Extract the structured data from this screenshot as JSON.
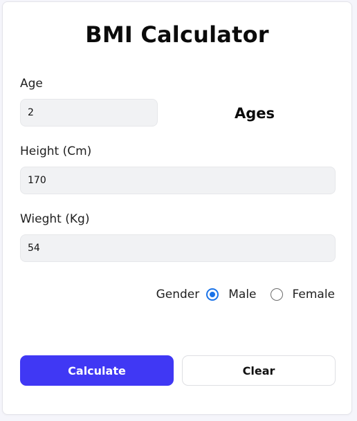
{
  "title": "BMI Calculator",
  "age": {
    "label": "Age",
    "value": "2",
    "side_label": "Ages"
  },
  "height": {
    "label": "Height (Cm)",
    "value": "170"
  },
  "weight": {
    "label": "Wieght (Kg)",
    "value": "54"
  },
  "gender": {
    "label": "Gender",
    "options": [
      {
        "label": "Male",
        "checked": true
      },
      {
        "label": "Female",
        "checked": false
      }
    ]
  },
  "buttons": {
    "calculate": "Calculate",
    "clear": "Clear"
  },
  "colors": {
    "accent": "#4038f4",
    "radio": "#1a73e8"
  }
}
